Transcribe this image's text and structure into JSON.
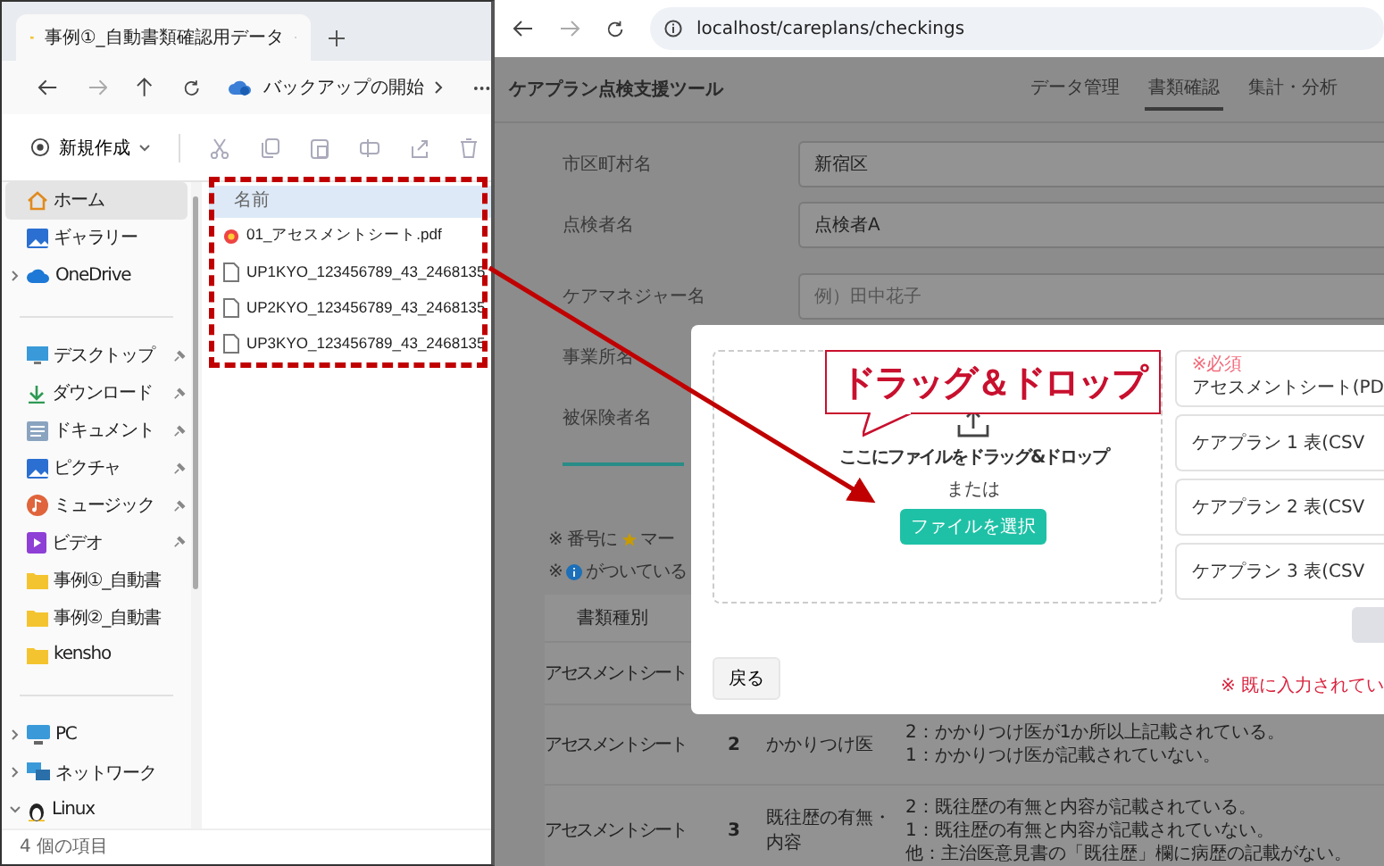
{
  "explorer": {
    "tab": {
      "title": "事例①_自動書類確認用データ"
    },
    "address": {
      "label": "バックアップの開始"
    },
    "toolbar": {
      "new_label": "新規作成"
    },
    "sidebar": {
      "groups": [
        [
          {
            "label": "ホーム",
            "kind": "home",
            "selected": true,
            "pinned": false
          },
          {
            "label": "ギャラリー",
            "kind": "gallery",
            "selected": false,
            "pinned": false
          },
          {
            "label": "OneDrive",
            "kind": "cloud",
            "selected": false,
            "pinned": false,
            "expanded": false
          }
        ],
        [
          {
            "label": "デスクトップ",
            "kind": "desktop",
            "selected": false,
            "pinned": true
          },
          {
            "label": "ダウンロード",
            "kind": "download",
            "selected": false,
            "pinned": true
          },
          {
            "label": "ドキュメント",
            "kind": "documents",
            "selected": false,
            "pinned": true
          },
          {
            "label": "ピクチャ",
            "kind": "pictures",
            "selected": false,
            "pinned": true
          },
          {
            "label": "ミュージック",
            "kind": "music",
            "selected": false,
            "pinned": true
          },
          {
            "label": "ビデオ",
            "kind": "video",
            "selected": false,
            "pinned": true
          },
          {
            "label": "事例①_自動書",
            "kind": "folder",
            "selected": false,
            "pinned": false
          },
          {
            "label": "事例②_自動書",
            "kind": "folder",
            "selected": false,
            "pinned": false
          },
          {
            "label": "kensho",
            "kind": "folder",
            "selected": false,
            "pinned": false
          }
        ],
        [
          {
            "label": "PC",
            "kind": "pc",
            "selected": false,
            "pinned": false,
            "expanded": false
          },
          {
            "label": "ネットワーク",
            "kind": "network",
            "selected": false,
            "pinned": false,
            "expanded": false
          },
          {
            "label": "Linux",
            "kind": "linux",
            "selected": false,
            "pinned": false,
            "expanded": true
          }
        ]
      ]
    },
    "files": {
      "column": "名前",
      "items": [
        {
          "name": "01_アセスメントシート.pdf",
          "kind": "pdf"
        },
        {
          "name": "UP1KYO_123456789_43_2468135",
          "kind": "file"
        },
        {
          "name": "UP2KYO_123456789_43_2468135",
          "kind": "file"
        },
        {
          "name": "UP3KYO_123456789_43_2468135",
          "kind": "file"
        }
      ]
    },
    "status_bar": "4 個の項目"
  },
  "browser": {
    "url": "localhost/careplans/checkings",
    "app_title": "ケアプラン点検支援ツール",
    "nav_tabs": [
      {
        "label": "データ管理",
        "selected": false
      },
      {
        "label": "書類確認",
        "selected": true
      },
      {
        "label": "集計・分析",
        "selected": false
      }
    ],
    "form": [
      {
        "label": "市区町村名",
        "value": "新宿区"
      },
      {
        "label": "点検者名",
        "value": "点検者A"
      },
      {
        "label": "ケアマネジャー名",
        "placeholder": "例）田中花子"
      },
      {
        "label": "事業所名"
      },
      {
        "label": "被保険者名"
      }
    ],
    "notes": [
      {
        "prefix": "※ 番号に",
        "kind": "star",
        "suffix": "マー"
      },
      {
        "prefix": "※",
        "kind": "info",
        "suffix": "がついている"
      }
    ],
    "table": {
      "column": "書類種別",
      "rows": [
        {
          "type": "アセスメントシート"
        },
        {
          "type": "アセスメントシート",
          "number": "2",
          "item": "かかりつけ医",
          "criteria": [
            "2：かかりつけ医が1か所以上記載されている。",
            "1：かかりつけ医が記載されていない。"
          ]
        },
        {
          "type": "アセスメントシート",
          "number": "3",
          "item": "既往歴の有無・内容",
          "criteria": [
            "2：既往歴の有無と内容が記載されている。",
            "1：既往歴の有無と内容が記載されていない。",
            "他：主治医意見書の「既往歴」欄に病歴の記載がない。"
          ]
        }
      ]
    }
  },
  "modal": {
    "drop_text": "ここにファイルをドラッグ&ドロップ",
    "or_text": "または",
    "choose_button": "ファイルを選択",
    "slots": [
      {
        "label": "アセスメントシート(PD",
        "required": "※必須"
      },
      {
        "label": "ケアプラン 1 表(CSV"
      },
      {
        "label": "ケアプラン 2 表(CSV"
      },
      {
        "label": "ケアプラン 3 表(CSV"
      }
    ],
    "back_button": "戻る",
    "warning": "※ 既に入力されてい"
  },
  "callout": {
    "text": "ドラッグ＆ドロップ"
  }
}
